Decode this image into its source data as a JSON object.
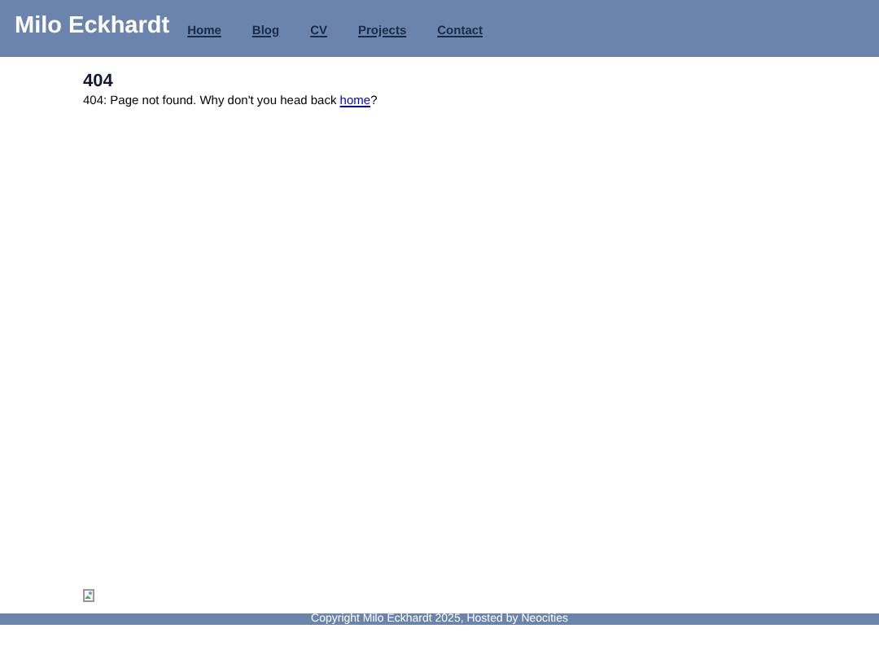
{
  "header": {
    "title": "Milo Eckhardt",
    "nav": [
      "Home",
      "Blog",
      "CV",
      "Projects",
      "Contact"
    ]
  },
  "main": {
    "heading": "404",
    "message_before": "404: Page not found. Why don't you head back ",
    "link": "home",
    "message_after": "?"
  },
  "footer": {
    "text": "Copyright Milo Eckhardt 2025, Hosted by Neocities"
  }
}
